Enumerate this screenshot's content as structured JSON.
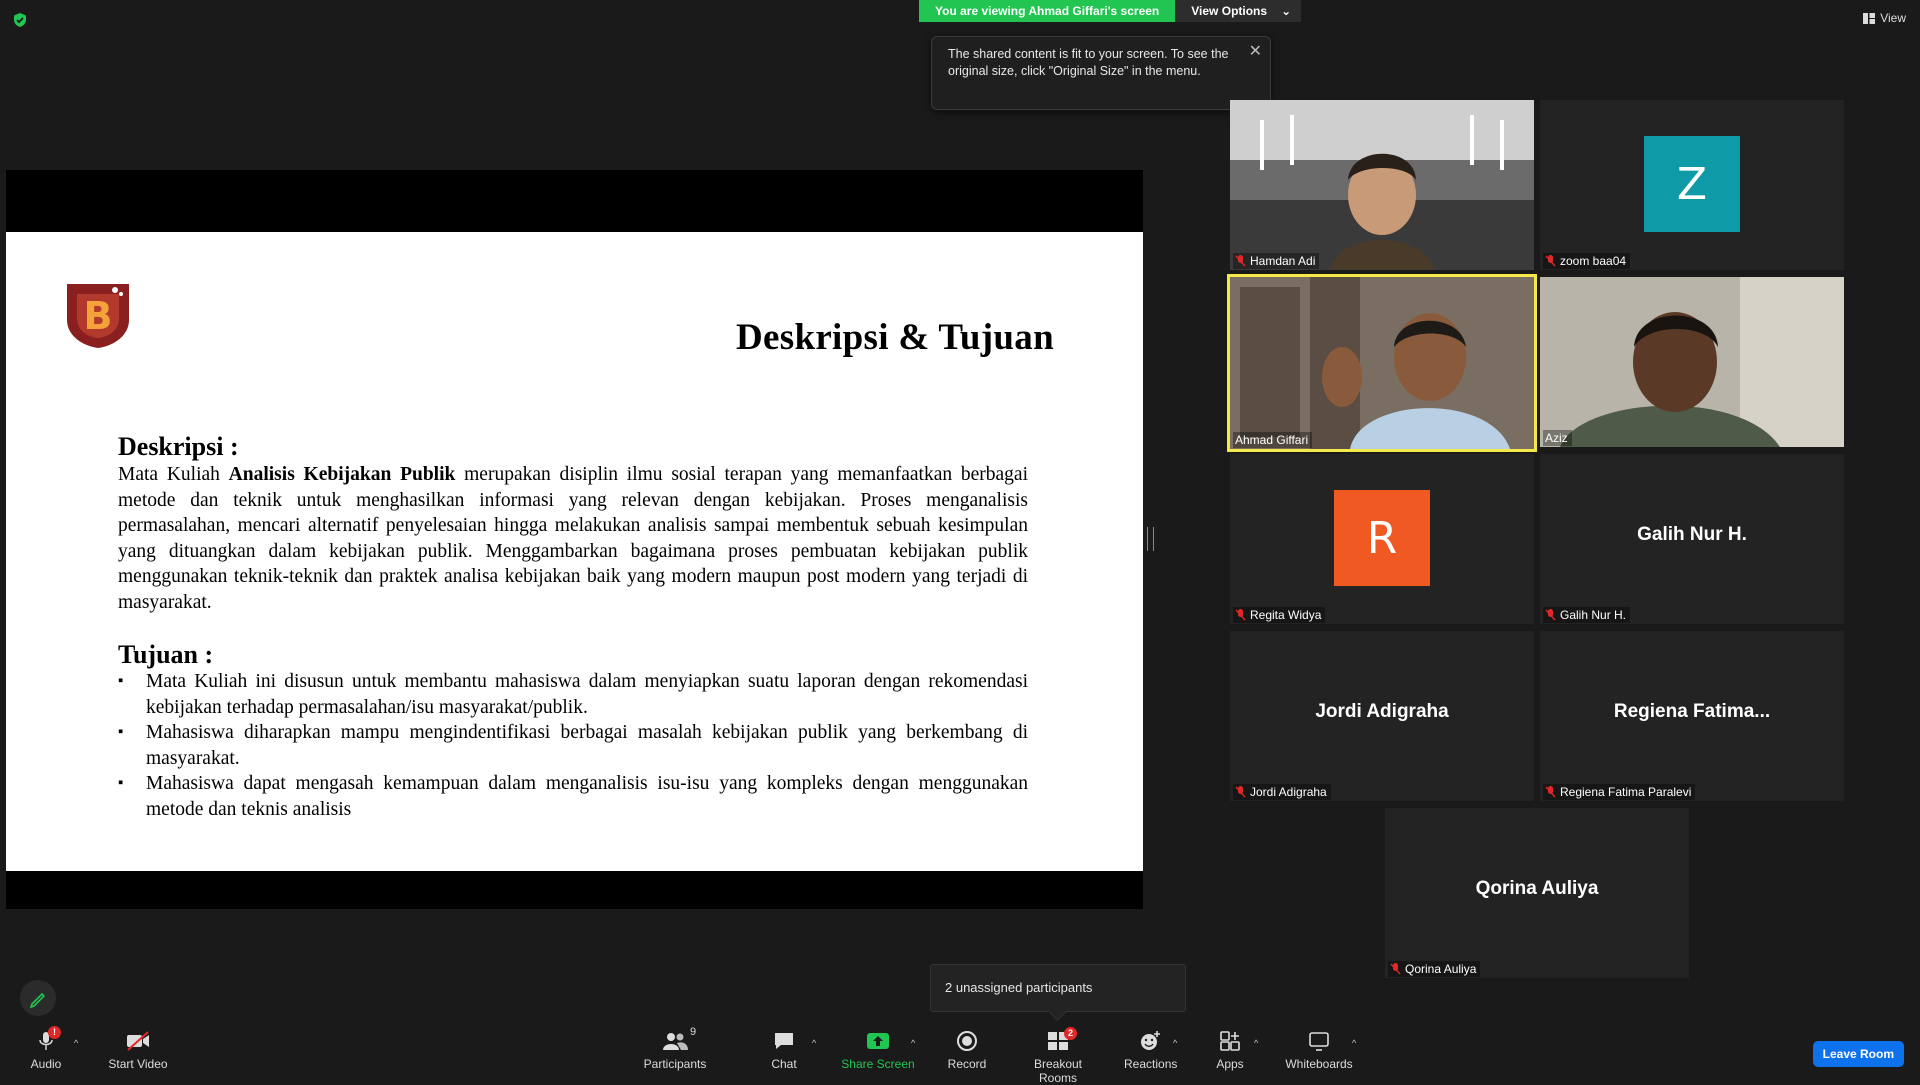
{
  "top": {
    "viewing_banner": "You are viewing Ahmad Giffari's screen",
    "view_options": "View Options",
    "view_button": "View",
    "tooltip": "The shared content is fit to your screen. To see the original size, click \"Original Size\" in the menu."
  },
  "slide": {
    "title": "Deskripsi & Tujuan",
    "deskripsi_heading": "Deskripsi :",
    "deskripsi_pre": "Mata Kuliah ",
    "deskripsi_bold": "Analisis Kebijakan Publik",
    "deskripsi_rest": " merupakan disiplin ilmu sosial terapan yang memanfaatkan berbagai metode dan teknik untuk menghasilkan informasi yang relevan dengan kebijakan. Proses menganalisis permasalahan, mencari alternatif penyelesaian hingga melakukan analisis sampai membentuk sebuah kesimpulan yang dituangkan dalam kebijakan publik. Menggambarkan bagaimana proses pembuatan kebijakan publik menggunakan teknik-teknik dan praktek analisa kebijakan baik yang modern maupun post modern yang terjadi di masyarakat.",
    "tujuan_heading": "Tujuan :",
    "tujuan_items": [
      "Mata Kuliah ini disusun untuk  membantu mahasiswa dalam menyiapkan suatu laporan dengan rekomendasi kebijakan terhadap permasalahan/isu masyarakat/publik.",
      "Mahasiswa diharapkan mampu mengindentifikasi berbagai masalah kebijakan publik yang berkembang di masyarakat.",
      "Mahasiswa dapat mengasah kemampuan dalam menganalisis isu-isu yang kompleks dengan menggunakan metode dan teknis analisis"
    ]
  },
  "participants": {
    "hamdan": "Hamdan Adi",
    "zoom": "zoom baa04",
    "zoom_initial": "Z",
    "ahmad": "Ahmad Giffari",
    "aziz": "Aziz",
    "regita": "Regita Widya",
    "regita_initial": "R",
    "galih_big": "Galih Nur H.",
    "galih": "Galih Nur H.",
    "jordi_big": "Jordi Adigraha",
    "jordi": "Jordi Adigraha",
    "regiena_big": "Regiena  Fatima...",
    "regiena": "Regiena Fatima Paralevi",
    "qorina_big": "Qorina Auliya",
    "qorina": "Qorina Auliya"
  },
  "colors": {
    "zoom_avatar": "#0f9aa8",
    "regita_avatar": "#f05a22",
    "active_speaker": "#f5e94a",
    "banner_green": "#23c552",
    "leave": "#0e72ed"
  },
  "unassigned": "2 unassigned participants",
  "toolbar": {
    "audio": "Audio",
    "audio_badge": "!",
    "start_video": "Start Video",
    "participants": "Participants",
    "participants_count": "9",
    "chat": "Chat",
    "share_screen": "Share Screen",
    "record": "Record",
    "breakout_rooms": "Breakout Rooms",
    "breakout_badge": "2",
    "reactions": "Reactions",
    "apps": "Apps",
    "whiteboards": "Whiteboards",
    "leave_room": "Leave Room"
  }
}
